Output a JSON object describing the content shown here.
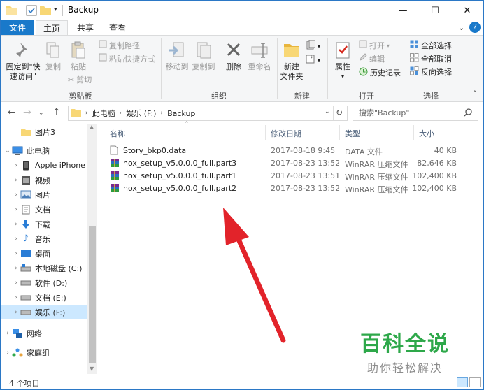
{
  "window": {
    "title": "Backup",
    "minimize": "—",
    "maximize": "☐",
    "close": "✕"
  },
  "tabs": [
    {
      "label": "文件"
    },
    {
      "label": "主页"
    },
    {
      "label": "共享"
    },
    {
      "label": "查看"
    }
  ],
  "ribbon": {
    "clipboard": {
      "pin_label_1": "固定到\"快",
      "pin_label_2": "速访问\"",
      "copy": "复制",
      "paste": "粘贴",
      "copy_path": "复制路径",
      "paste_shortcut": "粘贴快捷方式",
      "cut": "剪切",
      "group": "剪贴板"
    },
    "organize": {
      "move_to": "移动到",
      "copy_to": "复制到",
      "delete": "删除",
      "rename": "重命名",
      "group": "组织"
    },
    "new": {
      "new_folder_1": "新建",
      "new_folder_2": "文件夹",
      "group": "新建"
    },
    "open": {
      "properties": "属性",
      "open": "打开",
      "edit": "编辑",
      "history": "历史记录",
      "group": "打开"
    },
    "select": {
      "select_all": "全部选择",
      "select_none": "全部取消",
      "invert": "反向选择",
      "group": "选择"
    }
  },
  "address": {
    "crumbs": [
      "此电脑",
      "娱乐 (F:)",
      "Backup"
    ],
    "search_placeholder": "搜索\"Backup\""
  },
  "nav": {
    "items": [
      {
        "label": "图片3"
      },
      {
        "label": "此电脑"
      },
      {
        "label": "Apple iPhone"
      },
      {
        "label": "视频"
      },
      {
        "label": "图片"
      },
      {
        "label": "文档"
      },
      {
        "label": "下载"
      },
      {
        "label": "音乐"
      },
      {
        "label": "桌面"
      },
      {
        "label": "本地磁盘 (C:)"
      },
      {
        "label": "软件 (D:)"
      },
      {
        "label": "文档 (E:)"
      },
      {
        "label": "娱乐 (F:)"
      },
      {
        "label": "网络"
      },
      {
        "label": "家庭组"
      }
    ]
  },
  "table": {
    "headers": {
      "name": "名称",
      "date": "修改日期",
      "type": "类型",
      "size": "大小"
    },
    "rows": [
      {
        "name": "Story_bkp0.data",
        "date": "2017-08-18 9:45",
        "type": "DATA 文件",
        "size": "40 KB",
        "icon": "file-icon"
      },
      {
        "name": "nox_setup_v5.0.0.0_full.part3",
        "date": "2017-08-23 13:52",
        "type": "WinRAR 压缩文件",
        "size": "82,646 KB",
        "icon": "winrar-icon"
      },
      {
        "name": "nox_setup_v5.0.0.0_full.part1",
        "date": "2017-08-23 13:51",
        "type": "WinRAR 压缩文件",
        "size": "102,400 KB",
        "icon": "winrar-icon"
      },
      {
        "name": "nox_setup_v5.0.0.0_full.part2",
        "date": "2017-08-23 13:52",
        "type": "WinRAR 压缩文件",
        "size": "102,400 KB",
        "icon": "winrar-icon"
      }
    ]
  },
  "status": {
    "count": "4 个项目"
  },
  "watermark": {
    "line1": "百科全说",
    "line2": "助你轻松解决"
  },
  "colors": {
    "accent": "#1979ca",
    "selection": "#cce8ff",
    "arrow": "#e2232a",
    "watermark_green": "#2ea84a"
  }
}
